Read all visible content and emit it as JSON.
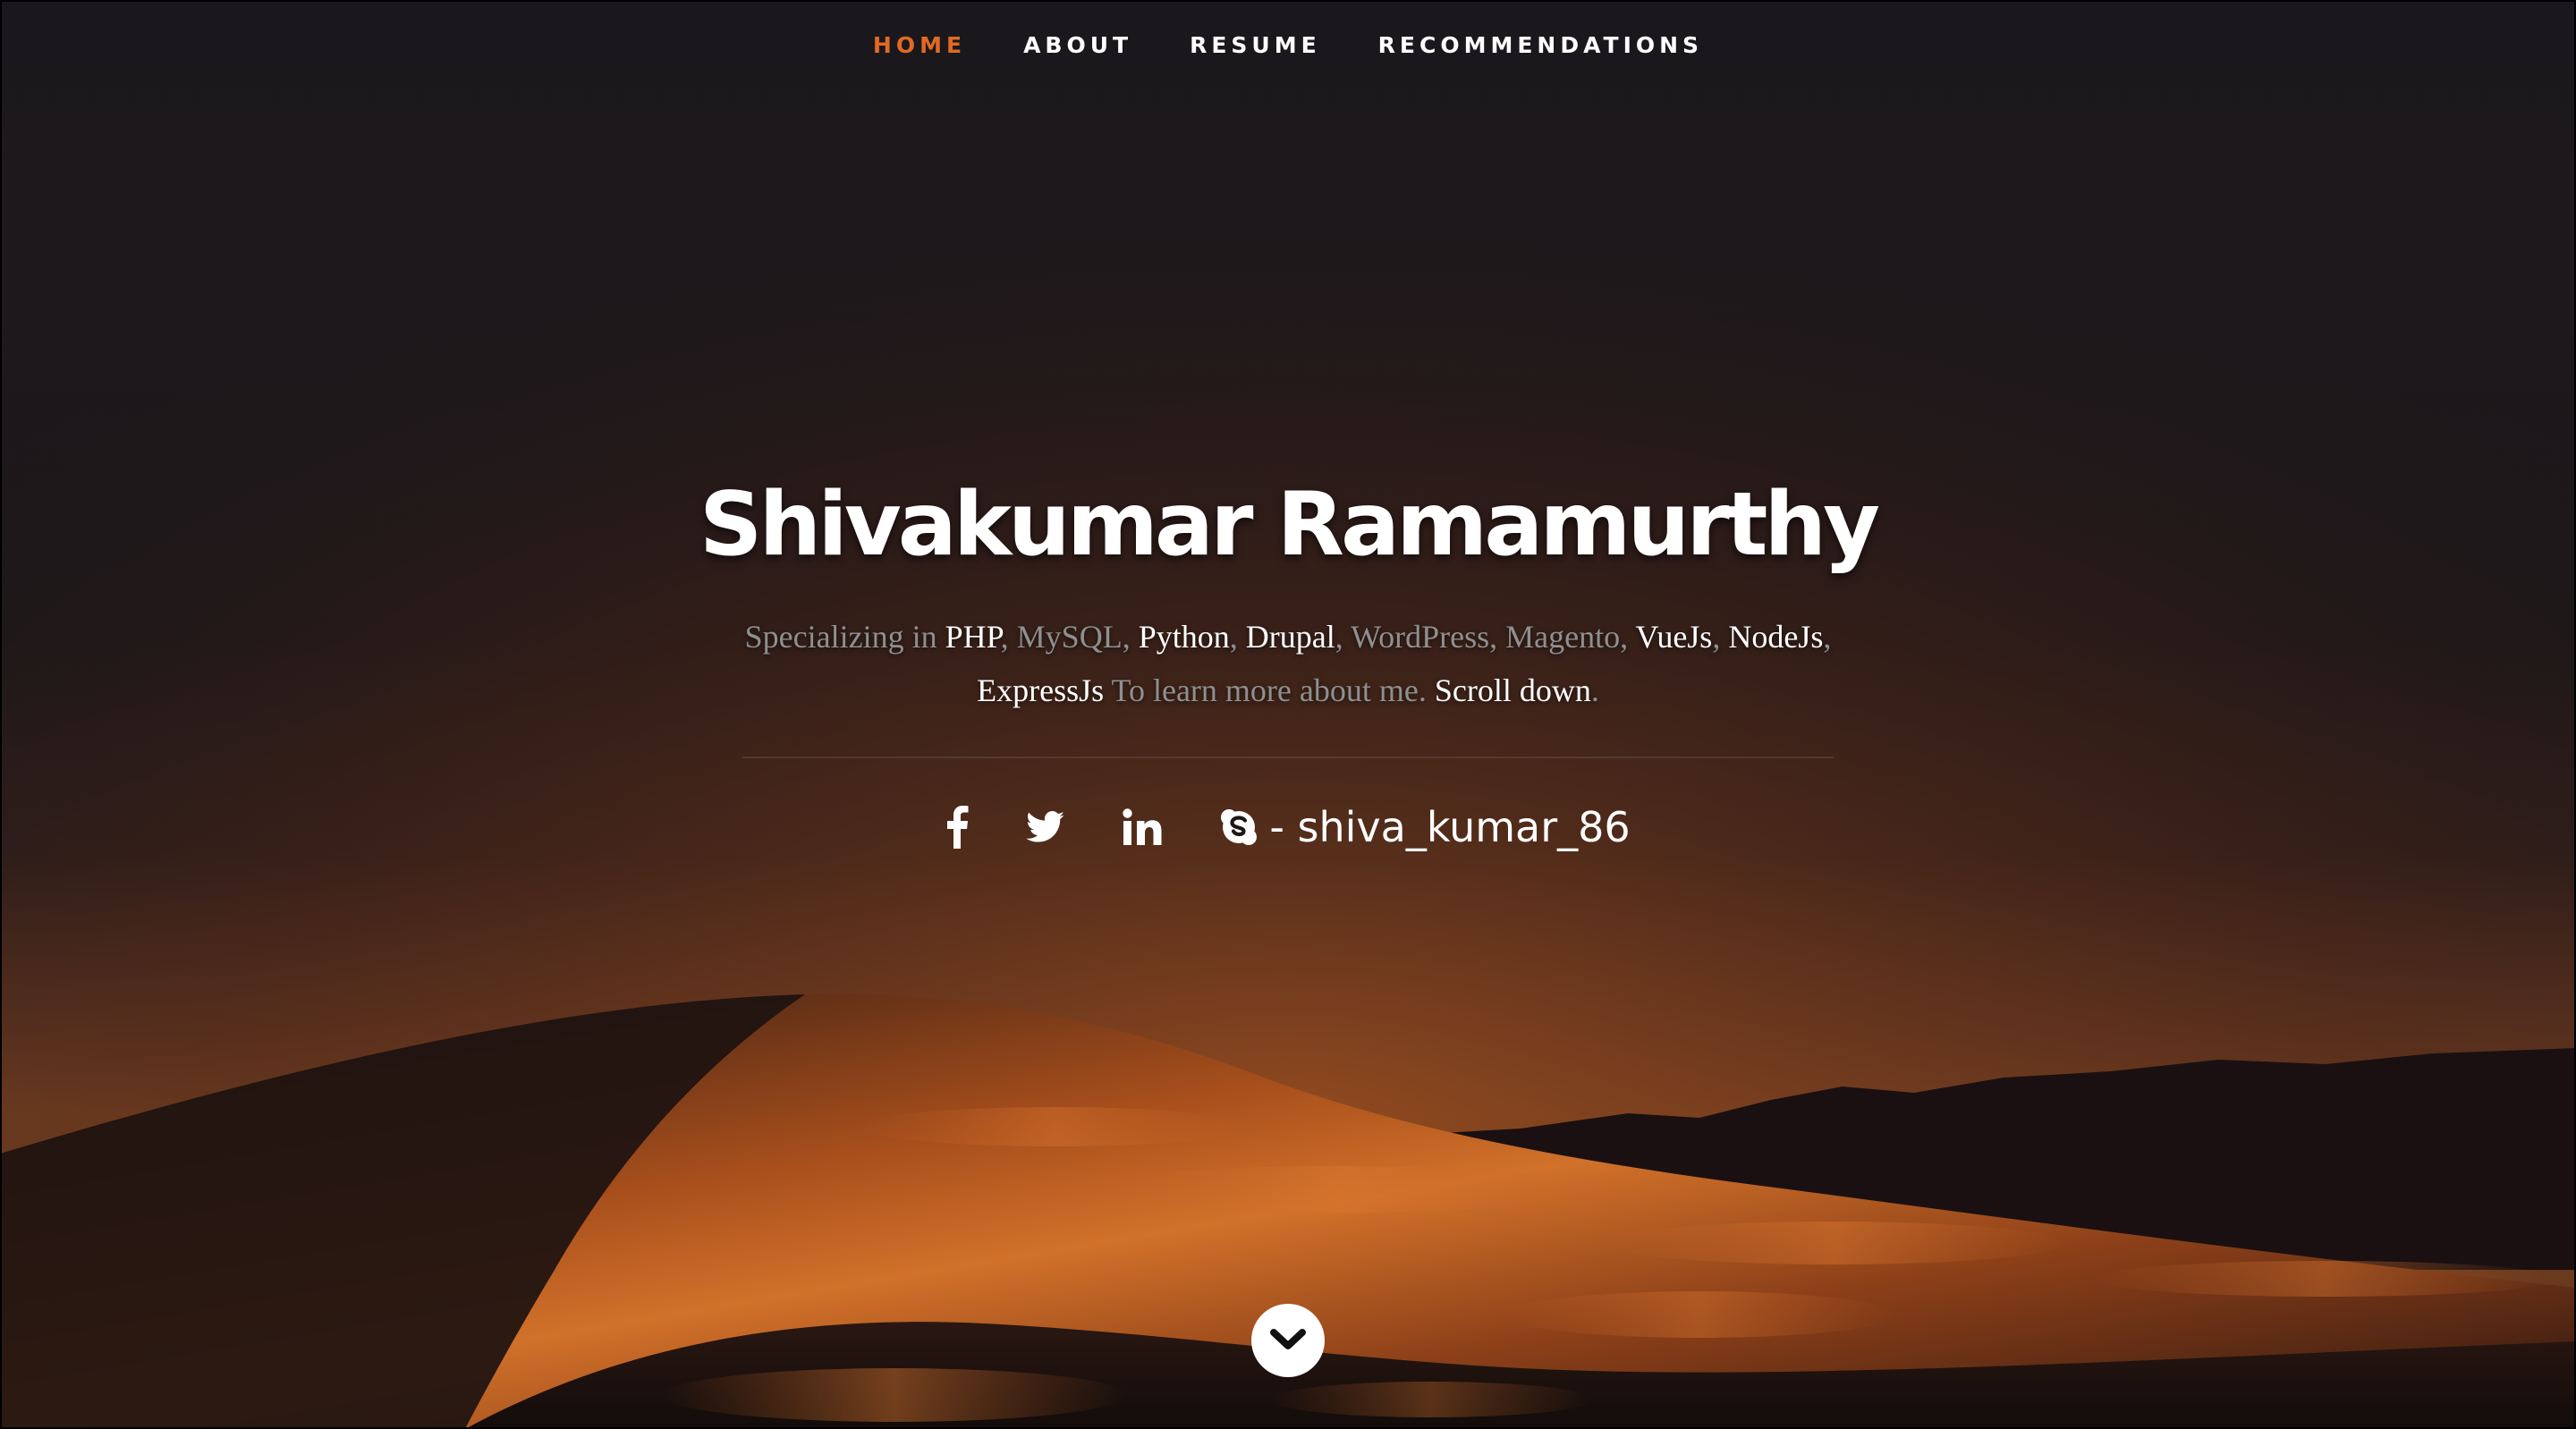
{
  "nav": {
    "items": [
      {
        "label": "HOME",
        "active": true
      },
      {
        "label": "ABOUT",
        "active": false
      },
      {
        "label": "RESUME",
        "active": false
      },
      {
        "label": "RECOMMENDATIONS",
        "active": false
      }
    ]
  },
  "hero": {
    "title": "Shivakumar Ramamurthy",
    "description": {
      "prefix": "Specializing in ",
      "skills": [
        "PHP",
        "MySQL",
        "Python",
        "Drupal",
        "WordPress",
        "Magento",
        "VueJs",
        "NodeJs",
        "ExpressJs"
      ],
      "highlighted_skills": [
        "PHP",
        "Python",
        "Drupal",
        "VueJs",
        "NodeJs",
        "ExpressJs"
      ],
      "middle": " To learn more about me. ",
      "link": "Scroll down",
      "suffix": "."
    }
  },
  "social": {
    "icons": [
      "facebook-icon",
      "twitter-icon",
      "linkedin-icon",
      "skype-icon"
    ],
    "skype_handle": "- shiva_kumar_86"
  },
  "scroll_button": {
    "icon": "chevron-down-icon"
  },
  "colors": {
    "accent": "#e06a23",
    "text": "#ffffff",
    "muted": "#8f8f8f"
  }
}
